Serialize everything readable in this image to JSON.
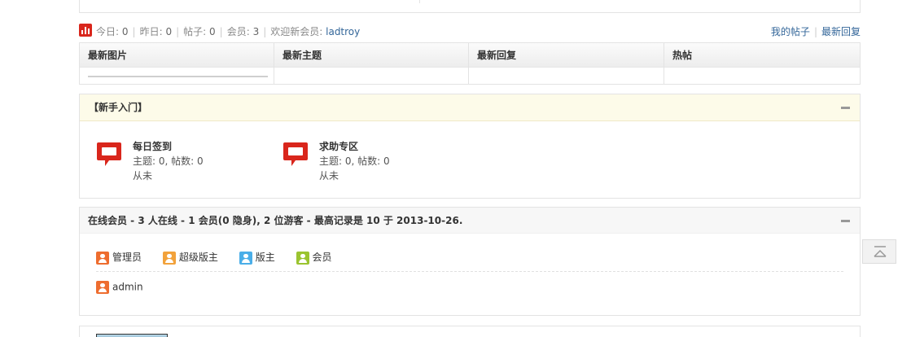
{
  "stats": {
    "today_label": "今日:",
    "today_value": "0",
    "yesterday_label": "昨日:",
    "yesterday_value": "0",
    "posts_label": "帖子:",
    "posts_value": "0",
    "members_label": "会员:",
    "members_value": "3",
    "welcome_label": "欢迎新会员:",
    "newest_member": "ladtroy",
    "my_posts_link": "我的帖子",
    "latest_replies_link": "最新回复"
  },
  "latest_grid": {
    "columns": [
      "最新图片",
      "最新主题",
      "最新回复",
      "热帖"
    ]
  },
  "newbie": {
    "title": "【新手入门】",
    "forums": [
      {
        "name": "每日签到",
        "meta": "主题: 0, 帖数: 0",
        "last": "从未"
      },
      {
        "name": "求助专区",
        "meta": "主题: 0, 帖数: 0",
        "last": "从未"
      }
    ]
  },
  "online": {
    "title": "在线会员 - 3 人在线 - 1 会员(0 隐身), 2 位游客 - 最高记录是 10 于 2013-10-26.",
    "legend": [
      {
        "label": "管理员",
        "color": "#ee6d2f"
      },
      {
        "label": "超级版主",
        "color": "#f2a23b"
      },
      {
        "label": "版主",
        "color": "#4aaee8"
      },
      {
        "label": "会员",
        "color": "#9bc430"
      }
    ],
    "members": [
      {
        "name": "admin",
        "color": "#ee6d2f"
      }
    ]
  },
  "colors": {
    "link": "#336699",
    "forum_icon": "#d9261c"
  }
}
